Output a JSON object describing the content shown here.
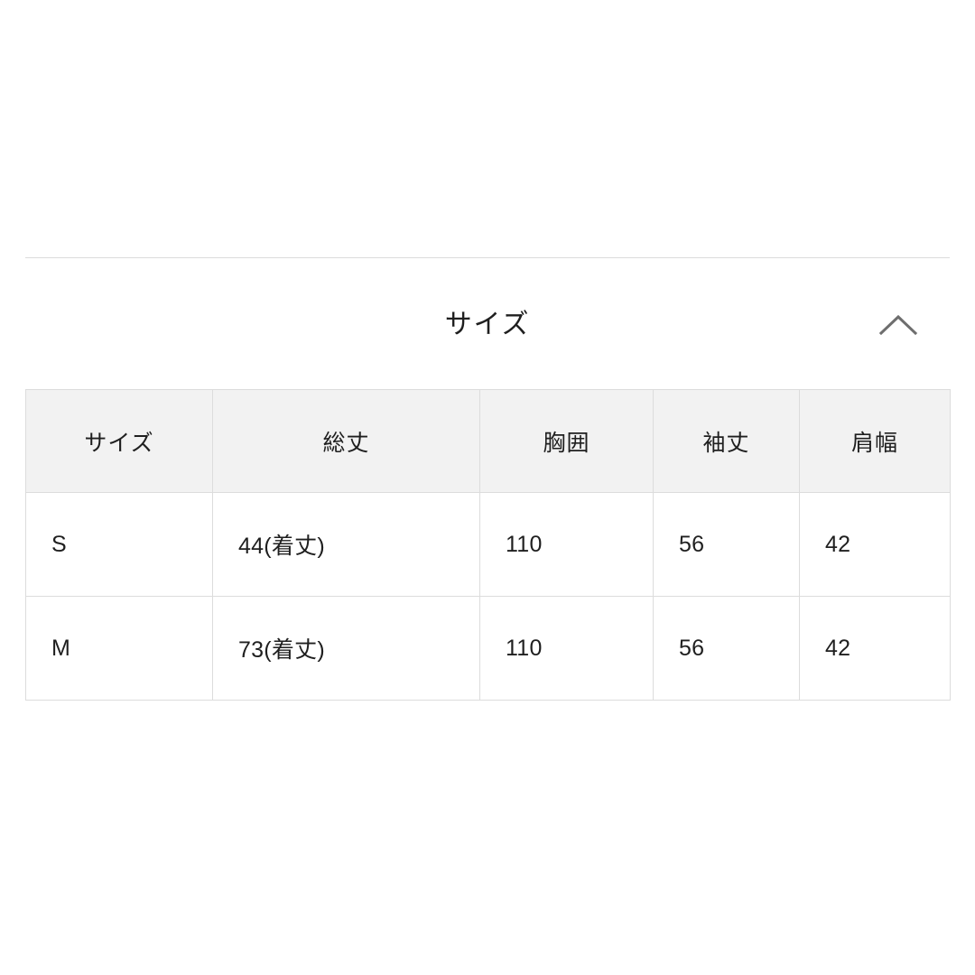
{
  "section": {
    "title": "サイズ",
    "collapse_icon": "chevron-up-icon",
    "collapsed": false
  },
  "colors": {
    "page_background": "#ffffff",
    "divider": "#dcdcdc",
    "table_border": "#dcdcdc",
    "header_cell_background": "#f2f2f2",
    "body_cell_background": "#ffffff",
    "text": "#1f1f1f",
    "icon": "#6e6e6e"
  },
  "size_table": {
    "headers": [
      "サイズ",
      "総丈",
      "胸囲",
      "袖丈",
      "肩幅"
    ],
    "rows": [
      {
        "size": "S",
        "total_length": "44(着丈)",
        "chest": "110",
        "sleeve_length": "56",
        "shoulder_width": "42"
      },
      {
        "size": "M",
        "total_length": "73(着丈)",
        "chest": "110",
        "sleeve_length": "56",
        "shoulder_width": "42"
      }
    ]
  }
}
